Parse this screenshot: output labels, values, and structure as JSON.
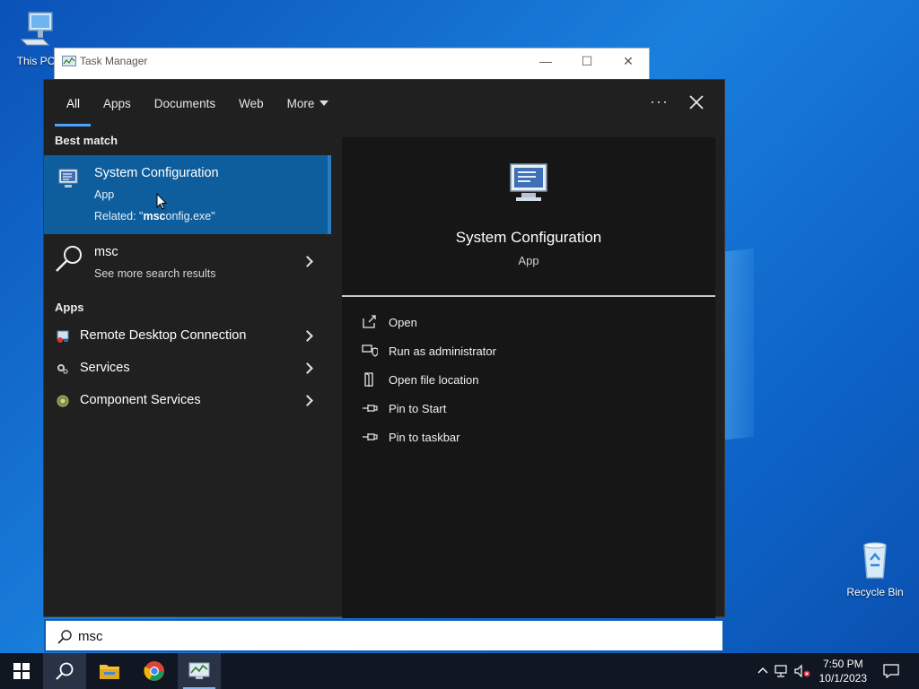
{
  "desktop": {
    "icons": [
      {
        "label": "This PC",
        "icon": "computer-icon"
      },
      {
        "label": "Recycle Bin",
        "icon": "recycle-bin-icon"
      }
    ]
  },
  "task_manager": {
    "title": "Task Manager",
    "controls": {
      "minimize": "—",
      "maximize": "☐",
      "close": "✕"
    }
  },
  "search": {
    "tabs": [
      {
        "label": "All",
        "active": true
      },
      {
        "label": "Apps"
      },
      {
        "label": "Documents"
      },
      {
        "label": "Web"
      },
      {
        "label": "More"
      }
    ],
    "more_options": "···",
    "close_icon": "close-icon",
    "best_match_label": "Best match",
    "best_match": {
      "title": "System Configuration",
      "type": "App",
      "related_prefix": "Related: \"",
      "related_bold": "msc",
      "related_rest": "onfig.exe\""
    },
    "web_result": {
      "query": "msc",
      "subtitle": "See more search results"
    },
    "apps_label": "Apps",
    "apps": [
      {
        "label": "Remote Desktop Connection",
        "icon": "remote-desktop-icon"
      },
      {
        "label": "Services",
        "icon": "services-gear-icon"
      },
      {
        "label": "Component Services",
        "icon": "component-services-icon"
      }
    ],
    "detail": {
      "title": "System Configuration",
      "type": "App",
      "actions": [
        {
          "label": "Open",
          "icon": "open-icon"
        },
        {
          "label": "Run as administrator",
          "icon": "shield-icon"
        },
        {
          "label": "Open file location",
          "icon": "file-location-icon"
        },
        {
          "label": "Pin to Start",
          "icon": "pin-icon"
        },
        {
          "label": "Pin to taskbar",
          "icon": "pin-icon"
        }
      ]
    },
    "input_value": "msc"
  },
  "taskbar": {
    "clock_time": "7:50 PM",
    "clock_date": "10/1/2023",
    "apps": [
      "start-icon",
      "search-icon",
      "file-explorer-icon",
      "chrome-icon",
      "task-manager-icon"
    ]
  },
  "colors": {
    "accent": "#0e5e9e",
    "tab_underline": "#4aa3ff",
    "panel_bg": "#202020",
    "detail_bg": "#161616"
  }
}
